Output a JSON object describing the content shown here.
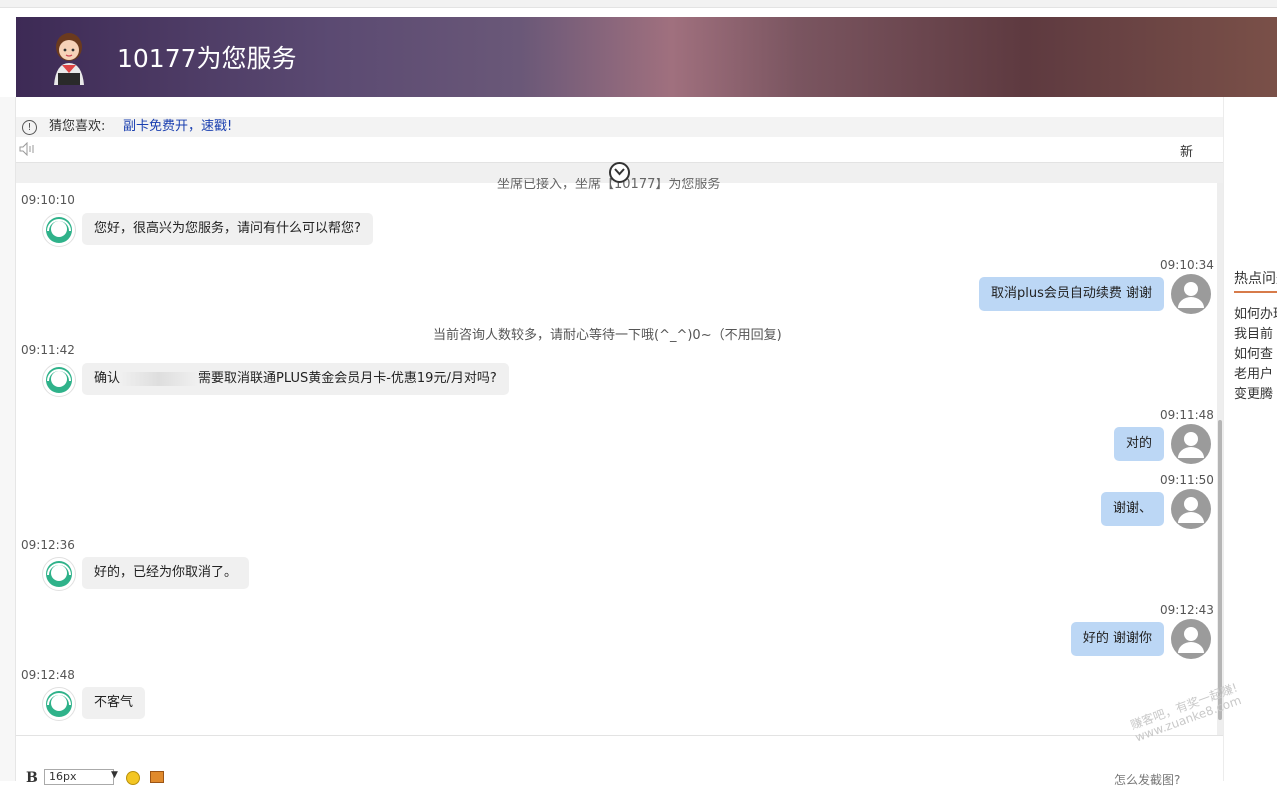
{
  "header": {
    "title": "10177为您服务",
    "avatar_icon": "customer-service-avatar-icon"
  },
  "notice": {
    "icon": "info-icon",
    "icon_glyph": "!",
    "label": "猜您喜欢:",
    "link": "副卡免费开，速戳!"
  },
  "sound": {
    "icon": "speaker-icon",
    "new_label": "新"
  },
  "chat": {
    "clipped_system": "坐席已接入，坐席【10177】为您服务",
    "messages": [
      {
        "side": "agent",
        "time": "09:10:10",
        "text": "您好，很高兴为您服务，请问有什么可以帮您?"
      },
      {
        "side": "user",
        "time": "09:10:34",
        "text": "取消plus会员自动续费 谢谢"
      },
      {
        "side": "system",
        "text": "当前咨询人数较多，请耐心等待一下哦(^_^)0~（不用回复)"
      },
      {
        "side": "agent",
        "time": "09:11:42",
        "text_prefix": "确认",
        "text_suffix": "需要取消联通PLUS黄金会员月卡-优惠19元/月对吗?"
      },
      {
        "side": "user",
        "time": "09:11:48",
        "text": "对的"
      },
      {
        "side": "user",
        "time": "09:11:50",
        "text": "谢谢、"
      },
      {
        "side": "agent",
        "time": "09:12:36",
        "text": "好的，已经为你取消了。"
      },
      {
        "side": "user",
        "time": "09:12:43",
        "text": "好的 谢谢你"
      },
      {
        "side": "agent",
        "time": "09:12:48",
        "text": "不客气"
      }
    ]
  },
  "right_panel": {
    "title": "热点问题",
    "items": [
      "如何办理",
      "我目前",
      "如何查",
      "老用户",
      "变更腾"
    ]
  },
  "toolbar": {
    "bold_label": "B",
    "font_size": "16px",
    "screenshot_link": "怎么发截图?"
  },
  "watermark": {
    "line1": "赚客吧，有奖一起赚!",
    "line2": "www.zuanke8.com"
  },
  "colors": {
    "user_bubble": "#bcd7f5",
    "agent_bubble": "#f0f0f0",
    "header_start": "#3d2a55",
    "header_end": "#7a5048",
    "link": "#1a3fb0"
  }
}
